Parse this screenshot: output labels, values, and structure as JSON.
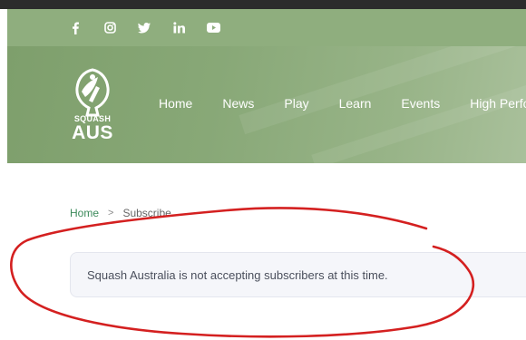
{
  "social": {
    "icons": [
      "facebook-icon",
      "instagram-icon",
      "twitter-icon",
      "linkedin-icon",
      "youtube-icon"
    ]
  },
  "logo": {
    "line1": "SQUASH",
    "line2": "AUS"
  },
  "nav": {
    "items": [
      "Home",
      "News",
      "Play",
      "Learn",
      "Events",
      "High Perform"
    ]
  },
  "breadcrumb": {
    "home": "Home",
    "separator": ">",
    "current": "Subscribe"
  },
  "alert": {
    "message": "Squash Australia is not accepting subscribers at this time."
  },
  "colors": {
    "social_bar": "#8fae7e",
    "hero": "#88a877",
    "breadcrumb_link": "#3b8a5a",
    "annotation": "#d42020"
  }
}
